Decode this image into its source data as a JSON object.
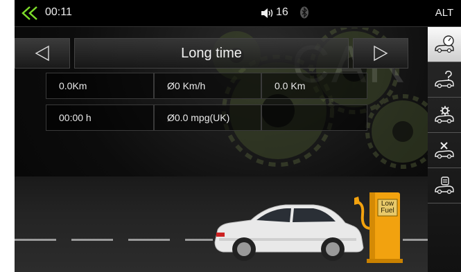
{
  "status_bar": {
    "time": "00:11",
    "volume": "16"
  },
  "sidebar": {
    "alt_label": "ALT",
    "buttons": [
      {
        "name": "trip-meter-icon",
        "active": true
      },
      {
        "name": "car-question-icon",
        "active": false
      },
      {
        "name": "car-settings-icon",
        "active": false
      },
      {
        "name": "car-service-icon",
        "active": false
      },
      {
        "name": "car-info-icon",
        "active": false
      }
    ]
  },
  "header": {
    "title": "Long time"
  },
  "background": {
    "watermark": "CAR"
  },
  "stats": {
    "row1": [
      "0.0Km",
      "Ø0 Km/h",
      "0.0 Km"
    ],
    "row2": [
      "00:00 h",
      "Ø0.0 mpg(UK)",
      ""
    ]
  },
  "fuel_pump": {
    "line1": "Low",
    "line2": "Fuel"
  },
  "colors": {
    "accent_green": "#7ddc2b",
    "pump_orange": "#f2a20f"
  }
}
